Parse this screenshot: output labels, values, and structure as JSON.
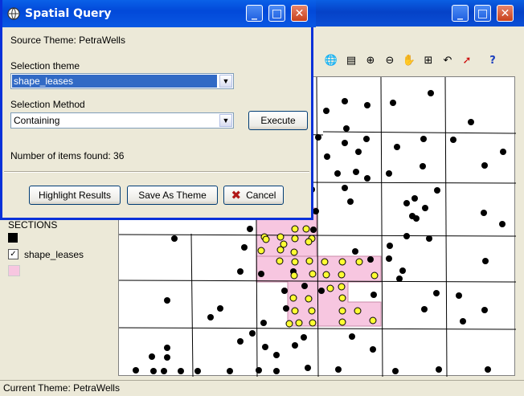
{
  "dialog": {
    "title": "Spatial Query",
    "source_theme": "Source Theme: PetraWells",
    "selection_theme_label": "Selection theme",
    "selection_theme_value": "shape_leases",
    "selection_method_label": "Selection Method",
    "selection_method_value": "Containing",
    "execute_label": "Execute",
    "items_found": "Number of items found: 36",
    "highlight_label": "Highlight Results",
    "save_label": "Save As Theme",
    "cancel_label": "Cancel"
  },
  "legend": {
    "sections_label": "SECTIONS",
    "leases_label": "shape_leases",
    "section_color": "#000000",
    "lease_color": "#f7c6e0"
  },
  "status": {
    "text": "Current Theme: PetraWells"
  },
  "toolbar": {
    "icons": [
      "globe-icon",
      "identify-icon",
      "zoom-in-icon",
      "zoom-out-icon",
      "pan-icon",
      "zoom-extent-icon",
      "undo-icon",
      "select-icon",
      "help-icon"
    ],
    "glyphs": [
      "🌐",
      "▤",
      "⊕",
      "⊖",
      "✋",
      "⊞",
      "↶",
      "➚",
      "?"
    ]
  },
  "colors": {
    "selected_well": "#ffff33",
    "well": "#000000",
    "lease_fill": "#f7c6e0"
  }
}
